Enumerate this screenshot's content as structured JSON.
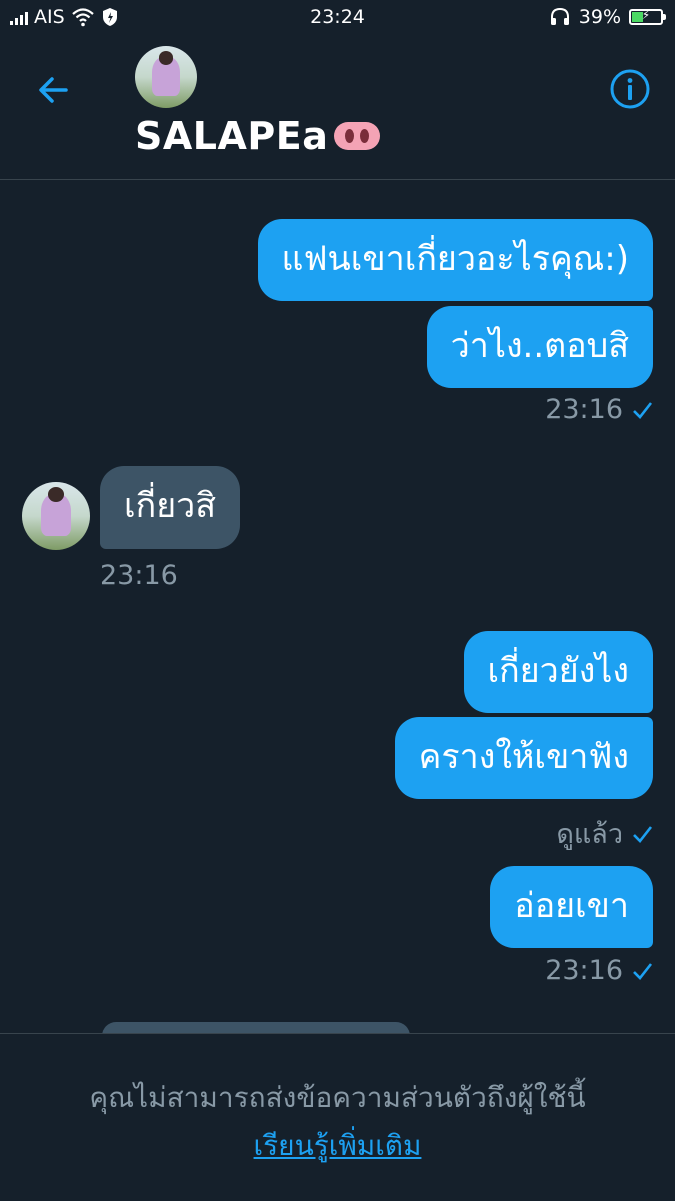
{
  "status_bar": {
    "carrier": "AIS",
    "time": "23:24",
    "battery_percent": "39%",
    "battery_level": 0.39
  },
  "header": {
    "contact_name": "SALAPEa",
    "name_emoji": "pig-nose-emoji",
    "back_icon": "arrow-left-icon",
    "info_icon": "info-icon"
  },
  "messages": [
    {
      "direction": "sent",
      "text": "แฟนเขาเกี่ยวอะไรคุณ:)"
    },
    {
      "direction": "sent",
      "text": "ว่าไง..ตอบสิ"
    },
    {
      "direction": "sent_meta",
      "text": "23:16"
    },
    {
      "direction": "received",
      "text": "เกี่ยวสิ"
    },
    {
      "direction": "received_meta",
      "text": "23:16"
    },
    {
      "direction": "sent",
      "text": "เกี่ยวยังไง"
    },
    {
      "direction": "sent",
      "text": "ครางให้เขาฟัง"
    },
    {
      "direction": "sent_meta",
      "text": "ดูแล้ว"
    },
    {
      "direction": "sent",
      "text": "อ่อยเขา"
    },
    {
      "direction": "sent_meta",
      "text": "23:16"
    }
  ],
  "footer": {
    "notice": "คุณไม่สามารถส่งข้อความส่วนตัวถึงผู้ใช้นี้",
    "learn_more": "เรียนรู้เพิ่มเติม"
  },
  "colors": {
    "background": "#15202b",
    "sent_bubble": "#1da1f2",
    "received_bubble": "#3d5466",
    "muted_text": "#8899a6",
    "accent": "#1da1f2"
  }
}
